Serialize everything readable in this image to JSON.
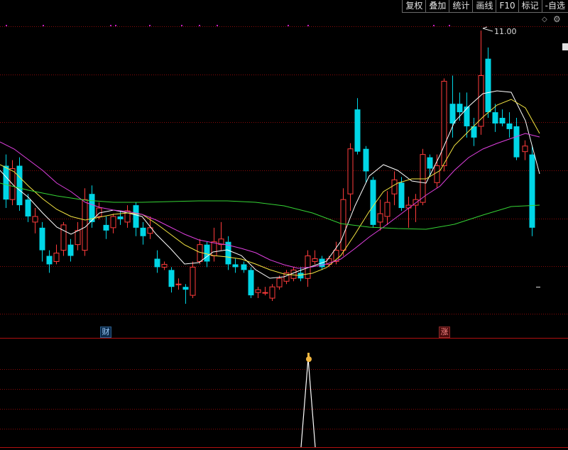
{
  "toolbar": {
    "buttons": [
      "复权",
      "叠加",
      "统计",
      "画线",
      "F10",
      "标记",
      "-自选"
    ]
  },
  "price_annotation": {
    "label": "11.00",
    "value": 11.0
  },
  "badges": {
    "finance": "财",
    "limit_up": "涨"
  },
  "icons": {
    "diamond": "diamond-icon",
    "settings": "gear-icon",
    "menu": "menu-box-icon",
    "hand": "pointing-hand-icon"
  },
  "colors": {
    "up": "#ff3b3b",
    "down": "#00d6e6",
    "ma5": "#ffffff",
    "ma10": "#f5e642",
    "ma20": "#e040e0",
    "ma60": "#35d435",
    "grid": "#8a0a0a",
    "dots": "#c020c0"
  }
}
